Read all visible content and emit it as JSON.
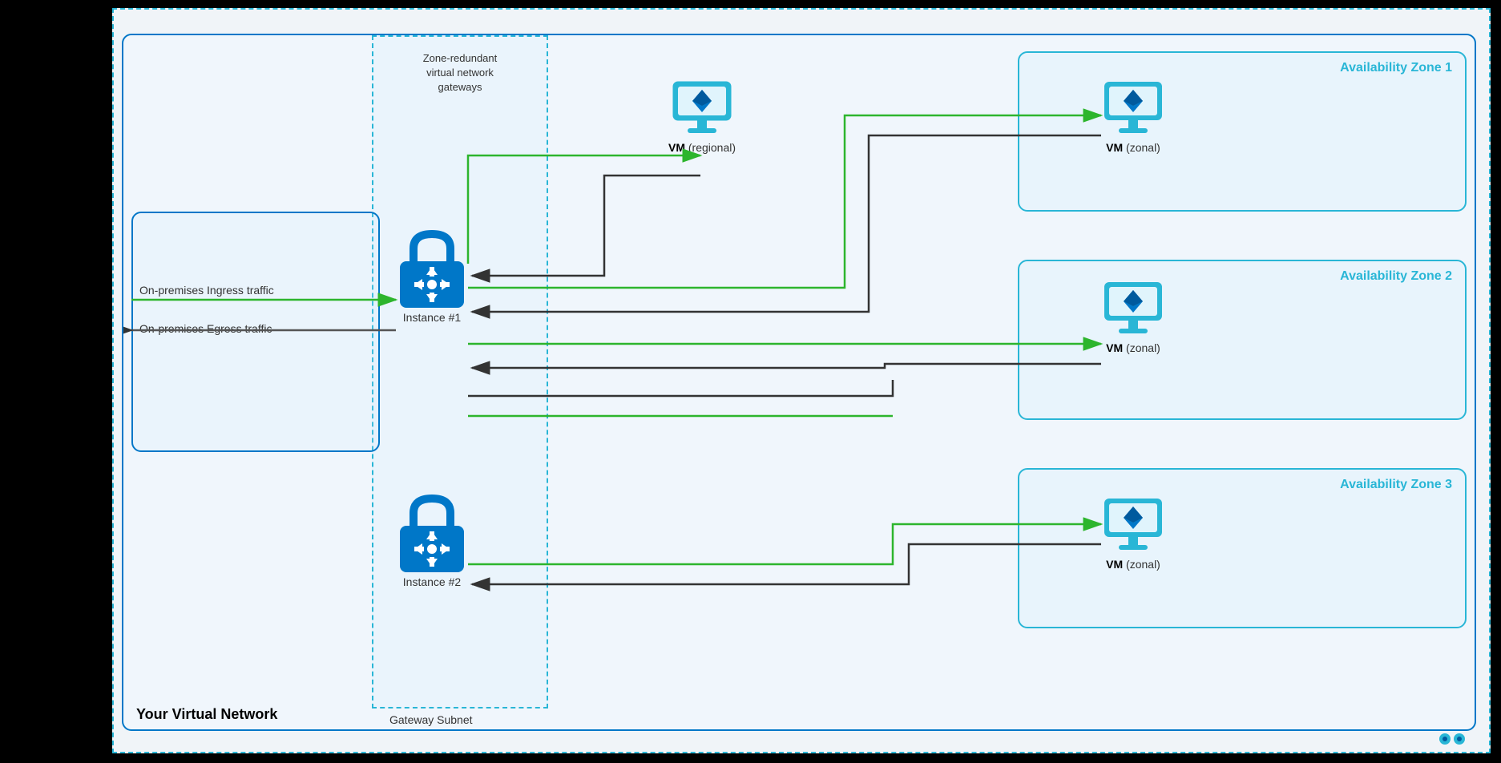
{
  "diagram": {
    "title": "Zone-redundant virtual network gateways",
    "vnet_label": "Your Virtual Network",
    "gateway_subnet_label": "Gateway Subnet",
    "zone_redundant_label": "Zone-redundant\nvirtual network\ngateways",
    "az_zones": [
      {
        "id": "az1",
        "label": "Availability Zone 1"
      },
      {
        "id": "az2",
        "label": "Availability Zone 2"
      },
      {
        "id": "az3",
        "label": "Availability Zone 3"
      }
    ],
    "instances": [
      {
        "id": "instance1",
        "label": "Instance #1"
      },
      {
        "id": "instance2",
        "label": "Instance #2"
      }
    ],
    "vms": [
      {
        "id": "vm-regional",
        "label": "VM",
        "type": "(regional)"
      },
      {
        "id": "vm-az1",
        "label": "VM",
        "type": "(zonal)"
      },
      {
        "id": "vm-az2",
        "label": "VM",
        "type": "(zonal)"
      },
      {
        "id": "vm-az3",
        "label": "VM",
        "type": "(zonal)"
      }
    ],
    "traffic_labels": [
      {
        "id": "ingress",
        "text": "On-premises Ingress traffic"
      },
      {
        "id": "egress",
        "text": "On-premises Egress traffic"
      }
    ]
  }
}
